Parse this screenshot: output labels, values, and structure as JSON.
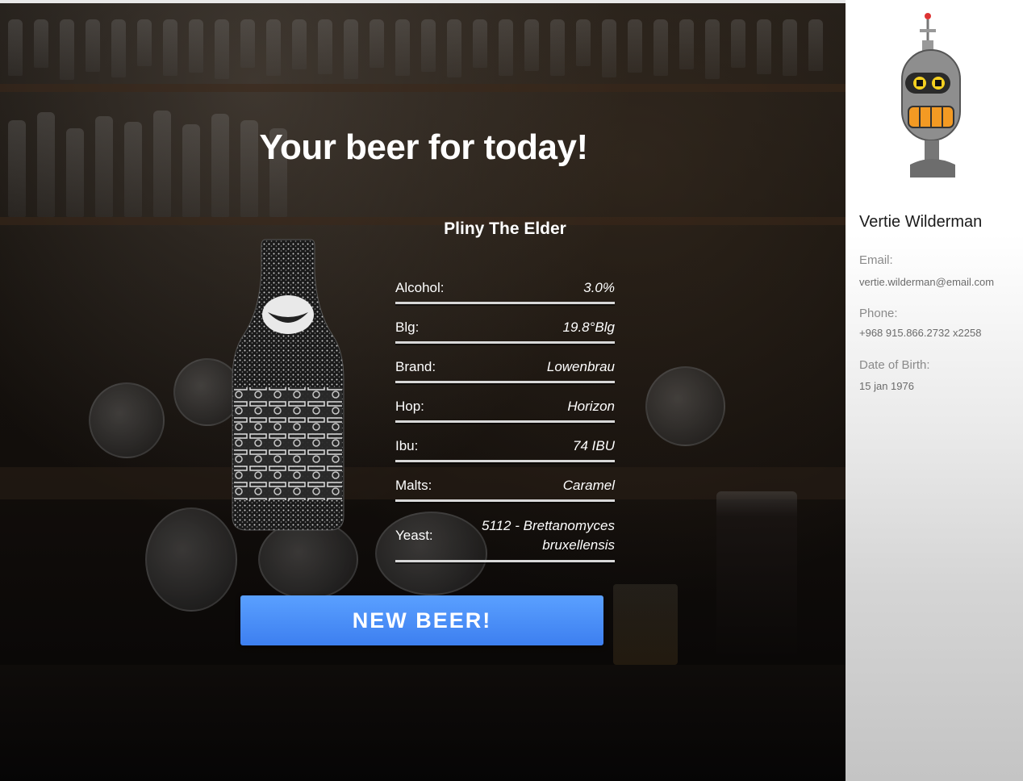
{
  "main": {
    "title": "Your beer for today!",
    "beer": {
      "name": "Pliny The Elder",
      "specs": [
        {
          "label": "Alcohol:",
          "value": "3.0%"
        },
        {
          "label": "Blg:",
          "value": "19.8°Blg"
        },
        {
          "label": "Brand:",
          "value": "Lowenbrau"
        },
        {
          "label": "Hop:",
          "value": "Horizon"
        },
        {
          "label": "Ibu:",
          "value": "74 IBU"
        },
        {
          "label": "Malts:",
          "value": "Caramel"
        },
        {
          "label": "Yeast:",
          "value": "5112 - Brettanomyces bruxellensis"
        }
      ]
    },
    "new_beer_button": "NEW BEER!"
  },
  "sidebar": {
    "user_name": "Vertie Wilderman",
    "email_label": "Email:",
    "email_value": "vertie.wilderman@email.com",
    "phone_label": "Phone:",
    "phone_value": "+968 915.866.2732 x2258",
    "dob_label": "Date of Birth:",
    "dob_value": "15 jan 1976"
  },
  "colors": {
    "button": "#4a8ff8",
    "sidebar_bg": "#ffffff",
    "title_text": "#ffffff"
  },
  "icons": {
    "avatar": "robot-avatar-icon",
    "bottle": "beer-bottle-icon"
  }
}
